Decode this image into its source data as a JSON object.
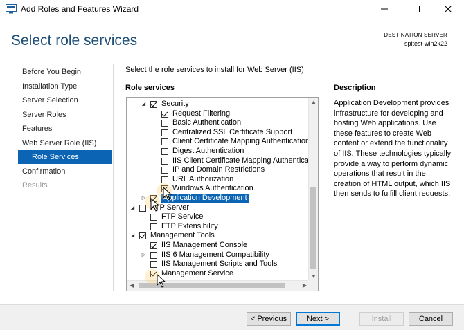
{
  "window": {
    "title": "Add Roles and Features Wizard"
  },
  "header": {
    "page_title": "Select role services",
    "destination_label": "DESTINATION SERVER",
    "destination_server": "spitest-win2k22"
  },
  "nav": {
    "items": [
      {
        "label": "Before You Begin",
        "state": "normal"
      },
      {
        "label": "Installation Type",
        "state": "normal"
      },
      {
        "label": "Server Selection",
        "state": "normal"
      },
      {
        "label": "Server Roles",
        "state": "normal"
      },
      {
        "label": "Features",
        "state": "normal"
      },
      {
        "label": "Web Server Role (IIS)",
        "state": "normal"
      },
      {
        "label": "Role Services",
        "state": "selected"
      },
      {
        "label": "Confirmation",
        "state": "normal"
      },
      {
        "label": "Results",
        "state": "disabled"
      }
    ]
  },
  "main": {
    "instruction": "Select the role services to install for Web Server (IIS)",
    "roles_heading": "Role services",
    "tree": [
      {
        "label": "Security",
        "checked": true,
        "expander": "expanded"
      },
      {
        "label": "Request Filtering",
        "checked": true
      },
      {
        "label": "Basic Authentication",
        "checked": false
      },
      {
        "label": "Centralized SSL Certificate Support",
        "checked": false
      },
      {
        "label": "Client Certificate Mapping Authentication",
        "checked": false
      },
      {
        "label": "Digest Authentication",
        "checked": false
      },
      {
        "label": "IIS Client Certificate Mapping Authentication",
        "checked": false
      },
      {
        "label": "IP and Domain Restrictions",
        "checked": false
      },
      {
        "label": "URL Authorization",
        "checked": false
      },
      {
        "label": "Windows Authentication",
        "checked": true
      },
      {
        "label": "Application Development",
        "checked": true,
        "expander": "collapsed",
        "highlighted": true
      },
      {
        "label": "FTP Server",
        "checked": false,
        "expander": "expanded"
      },
      {
        "label": "FTP Service",
        "checked": false
      },
      {
        "label": "FTP Extensibility",
        "checked": false
      },
      {
        "label": "Management Tools",
        "checked": true,
        "expander": "expanded"
      },
      {
        "label": "IIS Management Console",
        "checked": true
      },
      {
        "label": "IIS 6 Management Compatibility",
        "checked": false,
        "expander": "collapsed"
      },
      {
        "label": "IIS Management Scripts and Tools",
        "checked": false
      },
      {
        "label": "Management Service",
        "checked": true
      }
    ],
    "description_heading": "Description",
    "description_text": "Application Development provides infrastructure for developing and hosting Web applications. Use these features to create Web content or extend the functionality of IIS. These technologies typically provide a way to perform dynamic operations that result in the creation of HTML output, which IIS then sends to fulfill client requests."
  },
  "footer": {
    "previous_label": "< Previous",
    "next_label": "Next >",
    "install_label": "Install",
    "cancel_label": "Cancel"
  },
  "icons": {
    "app": "server-manager-icon",
    "minimize": "minimize-icon",
    "maximize": "maximize-icon",
    "close": "close-icon"
  }
}
